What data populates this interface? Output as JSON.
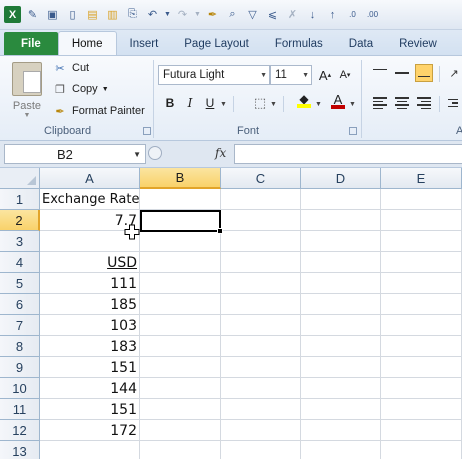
{
  "qat": {
    "icons": [
      "excel-logo-icon",
      "eraser-icon",
      "save-icon",
      "new-icon",
      "open-icon",
      "folder-icon",
      "attach-icon",
      "undo-icon",
      "redo-icon",
      "format-painter-icon",
      "print-preview-icon",
      "filter-icon",
      "filter-advanced-icon",
      "clear-filter-icon",
      "sort-asc-icon",
      "sort-desc-icon",
      "increase-decimal-icon",
      "decrease-decimal-icon"
    ]
  },
  "tabs": {
    "file": "File",
    "items": [
      "Home",
      "Insert",
      "Page Layout",
      "Formulas",
      "Data",
      "Review"
    ],
    "active": "Home"
  },
  "ribbon": {
    "clipboard": {
      "paste": "Paste",
      "cut": "Cut",
      "copy": "Copy",
      "format_painter": "Format Painter",
      "group_label": "Clipboard"
    },
    "font": {
      "font_name": "Futura Light",
      "font_size": "11",
      "bold": "B",
      "italic": "I",
      "underline": "U",
      "grow": "A˄",
      "shrink": "A˅",
      "font_color_letter": "A",
      "group_label": "Font"
    },
    "alignment": {
      "group_label": "A"
    },
    "colors": {
      "fill_color": "#ffff00",
      "font_color": "#c00000"
    }
  },
  "formula_bar": {
    "name_box": "B2",
    "fx": "fx",
    "formula": ""
  },
  "sheet": {
    "columns": [
      "A",
      "B",
      "C",
      "D",
      "E"
    ],
    "selected_column": "B",
    "rows": [
      "1",
      "2",
      "3",
      "4",
      "5",
      "6",
      "7",
      "8",
      "9",
      "10",
      "11",
      "12",
      "13"
    ],
    "selected_row": "2",
    "cells": {
      "A1": "Exchange Rate",
      "A2": "7.7",
      "A4": "USD",
      "A5": "111",
      "A6": "185",
      "A7": "103",
      "A8": "183",
      "A9": "151",
      "A10": "144",
      "A11": "151",
      "A12": "172"
    }
  }
}
